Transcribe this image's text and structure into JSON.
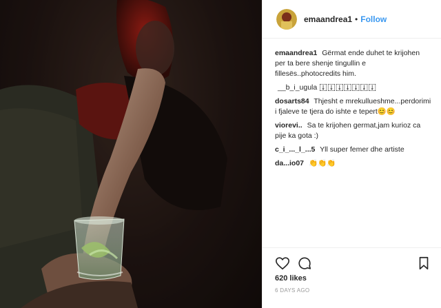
{
  "header": {
    "username": "emaandrea1",
    "separator": "•",
    "follow_label": "Follow"
  },
  "comments": [
    {
      "user": "emaandrea1",
      "text": "Gërmat ende duhet te krijohen per ta bere shenje tingullin e fillesës..photocredits him."
    },
    {
      "user": "",
      "text": "__b_i_ugula 𛲢𛲢𛲢𛲢𛲢𛲢𛲢"
    },
    {
      "user": "dosarts84",
      "text": "Thjesht e mrekullueshme...perdorimi i fjaleve te tjera do ishte e tepert😊😊"
    },
    {
      "user": "viorevi..",
      "text": "Sa te krijohen germat,jam kurioz ca pije ka gota :)"
    },
    {
      "user": "c_i_..._l_...5",
      "text": "Yll super femer dhe artiste"
    },
    {
      "user": "da...io07",
      "text": "👏👏👏"
    }
  ],
  "footer": {
    "likes": "620 likes",
    "age": "6 DAYS AGO"
  },
  "icons": {
    "like": "heart-icon",
    "comment": "comment-icon",
    "save": "bookmark-icon"
  },
  "colors": {
    "accent": "#3897f0",
    "text": "#262626",
    "muted": "#999999"
  }
}
